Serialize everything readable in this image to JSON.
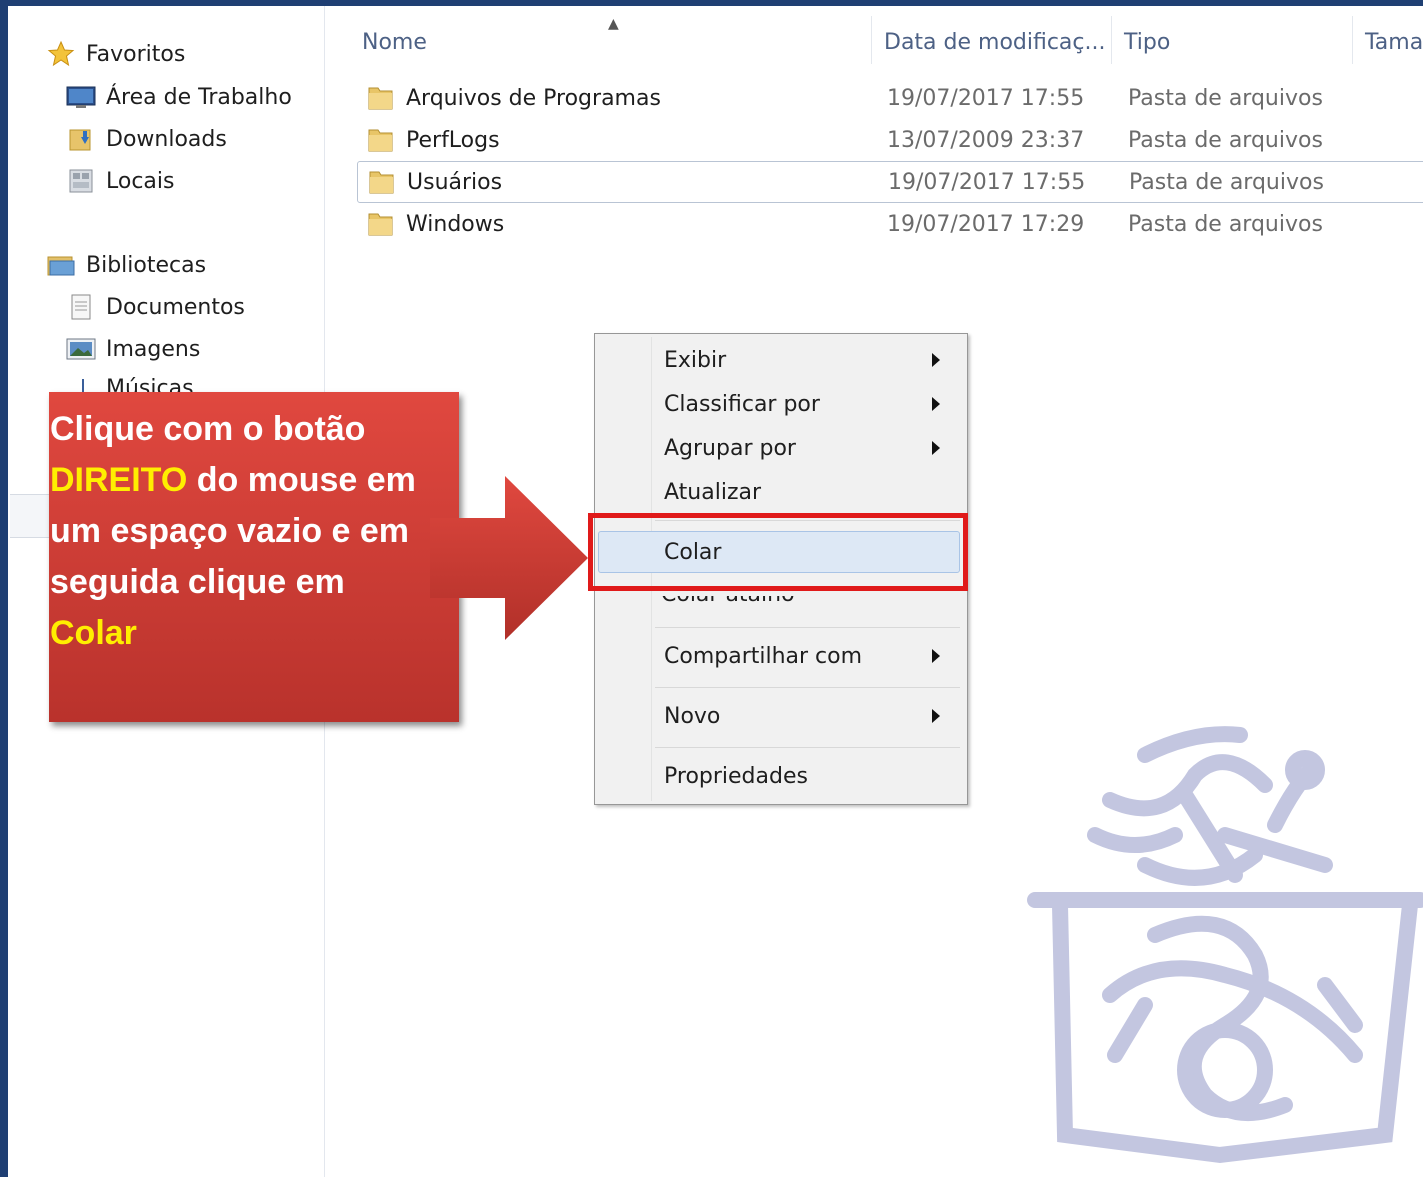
{
  "nav": {
    "favorites": "Favoritos",
    "items_favorites": [
      "Área de Trabalho",
      "Downloads",
      "Locais"
    ],
    "libraries": "Bibliotecas",
    "items_libraries": [
      "Documentos",
      "Imagens",
      "Músicas"
    ]
  },
  "columns": {
    "name": "Nome",
    "date": "Data de modificaç...",
    "type": "Tipo",
    "size": "Tama"
  },
  "files": [
    {
      "name": "Arquivos de Programas",
      "date": "19/07/2017 17:55",
      "type": "Pasta de arquivos"
    },
    {
      "name": "PerfLogs",
      "date": "13/07/2009 23:37",
      "type": "Pasta de arquivos"
    },
    {
      "name": "Usuários",
      "date": "19/07/2017 17:55",
      "type": "Pasta de arquivos"
    },
    {
      "name": "Windows",
      "date": "19/07/2017 17:29",
      "type": "Pasta de arquivos"
    }
  ],
  "context_menu": {
    "view": "Exibir",
    "sort_by": "Classificar por",
    "group_by": "Agrupar por",
    "refresh": "Atualizar",
    "paste": "Colar",
    "paste_shortcut": "Colar atalho",
    "share_with": "Compartilhar com",
    "new": "Novo",
    "properties": "Propriedades"
  },
  "callout": {
    "part1": "Clique com o botão ",
    "direito": "DIREITO",
    "part2": " do mouse em um espaço vazio e em seguida clique em ",
    "colar": "Colar"
  },
  "colors": {
    "highlight_box": "#e01a1a",
    "callout_bg": "#c83a33",
    "callout_highlight": "#ffee00",
    "menu_hover": "#dde8f5"
  }
}
